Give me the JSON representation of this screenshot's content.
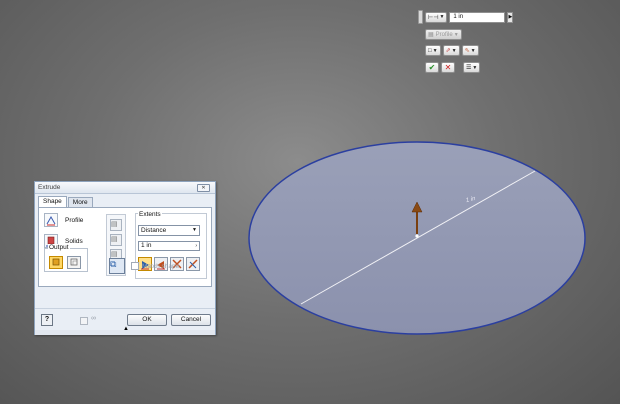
{
  "viewport": {
    "sketch_dimension": "1 in"
  },
  "minibar": {
    "distance_value": "1 in",
    "profile_label": "Profile",
    "icons": [
      "extents-icon",
      "profile-icon",
      "output-icon",
      "direction-icon",
      "taper-icon",
      "ok-icon",
      "cancel-icon",
      "menu-icon"
    ]
  },
  "dialog": {
    "title": "Extrude",
    "close_glyph": "✕",
    "tabs": [
      "Shape",
      "More"
    ],
    "profile_label": "Profile",
    "solids_label": "Solids",
    "output_label": "Output",
    "extents_label": "Extents",
    "extents_value": "Distance",
    "distance_value": "1 in",
    "match_shape_label": "Match shape",
    "ok_label": "OK",
    "cancel_label": "Cancel",
    "help_glyph": "?",
    "colors": {
      "active_button": "#ffd766",
      "panel_border": "#9aa9bd"
    }
  }
}
